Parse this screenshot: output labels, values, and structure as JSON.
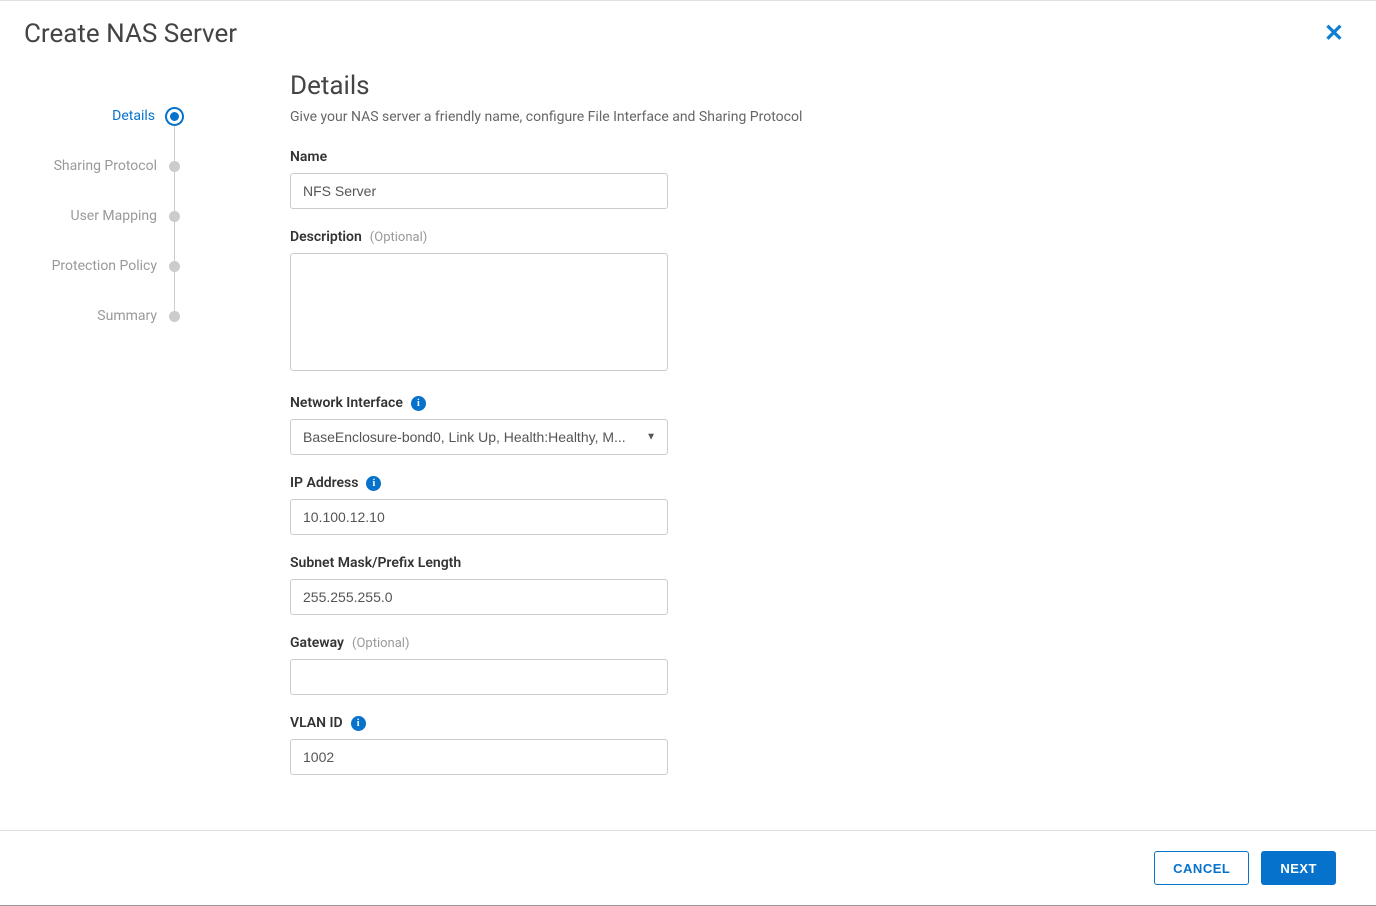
{
  "modal": {
    "title": "Create NAS Server"
  },
  "stepper": {
    "items": [
      {
        "label": "Details",
        "active": true
      },
      {
        "label": "Sharing Protocol",
        "active": false
      },
      {
        "label": "User Mapping",
        "active": false
      },
      {
        "label": "Protection Policy",
        "active": false
      },
      {
        "label": "Summary",
        "active": false
      }
    ]
  },
  "details": {
    "heading": "Details",
    "subtitle": "Give your NAS server a friendly name, configure File Interface and Sharing Protocol",
    "name_label": "Name",
    "name_value": "NFS Server",
    "description_label": "Description",
    "description_optional": "(Optional)",
    "description_value": "",
    "network_interface_label": "Network Interface",
    "network_interface_value": "BaseEnclosure-bond0, Link Up, Health:Healthy, M...",
    "ip_address_label": "IP Address",
    "ip_address_value": "10.100.12.10",
    "subnet_label": "Subnet Mask/Prefix Length",
    "subnet_value": "255.255.255.0",
    "gateway_label": "Gateway",
    "gateway_optional": "(Optional)",
    "gateway_value": "",
    "vlan_label": "VLAN ID",
    "vlan_value": "1002"
  },
  "footer": {
    "cancel": "CANCEL",
    "next": "NEXT"
  }
}
